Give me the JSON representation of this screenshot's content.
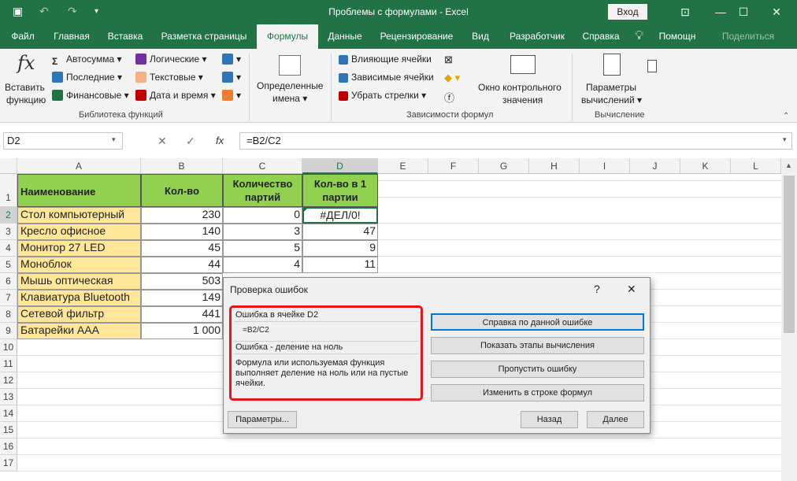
{
  "title_bar": {
    "title": "Проблемы с формулами - Excel",
    "login": "Вход"
  },
  "tabs": [
    "Файл",
    "Главная",
    "Вставка",
    "Разметка страницы",
    "Формулы",
    "Данные",
    "Рецензирование",
    "Вид",
    "Разработчик",
    "Справка",
    "Помощн",
    "Поделиться"
  ],
  "active_tab": "Формулы",
  "ribbon": {
    "insert_function": [
      "Вставить",
      "функцию"
    ],
    "lib_buttons": [
      "Автосумма",
      "Последние",
      "Финансовые",
      "Логические",
      "Текстовые",
      "Дата и время"
    ],
    "library_group": "Библиотека функций",
    "defined_names": [
      "Определенные",
      "имена"
    ],
    "dep_buttons": [
      "Влияющие ячейки",
      "Зависимые ячейки",
      "Убрать стрелки"
    ],
    "watch_window": [
      "Окно контрольного",
      "значения"
    ],
    "dependencies_group": "Зависимости формул",
    "calc_params": [
      "Параметры",
      "вычислений"
    ],
    "calc_group": "Вычисление"
  },
  "formula_bar": {
    "name_box": "D2",
    "fx": "fx",
    "formula": "=B2/C2"
  },
  "columns": [
    "A",
    "B",
    "C",
    "D",
    "E",
    "F",
    "G",
    "H",
    "I",
    "J",
    "K",
    "L"
  ],
  "rows": [
    "1",
    "2",
    "3",
    "4",
    "5",
    "6",
    "7",
    "8",
    "9",
    "10",
    "11",
    "12",
    "13",
    "14",
    "15",
    "16",
    "17"
  ],
  "table": {
    "headers": [
      "Наименование",
      "Кол-во",
      "Количество партий",
      "Кол-во в 1 партии"
    ],
    "rows": [
      [
        "Стол компьютерный",
        "230",
        "0",
        "#ДЕЛ/0!"
      ],
      [
        "Кресло офисное",
        "140",
        "3",
        "47"
      ],
      [
        "Монитор 27 LED",
        "45",
        "5",
        "9"
      ],
      [
        "Моноблок",
        "44",
        "4",
        "11"
      ],
      [
        "Мышь оптическая",
        "503",
        "",
        ""
      ],
      [
        "Клавиатура Bluetooth",
        "149",
        "",
        ""
      ],
      [
        "Сетевой фильтр",
        "441",
        "",
        ""
      ],
      [
        "Батарейки AAA",
        "1 000",
        "",
        ""
      ]
    ]
  },
  "dialog": {
    "title": "Проверка ошибок",
    "help_glyph": "?",
    "close_glyph": "✕",
    "error_cell": "Ошибка в ячейке D2",
    "formula": "=B2/C2",
    "error_type": "Ошибка  - деление на ноль",
    "description": "Формула или используемая функция выполняет деление на ноль или на пустые ячейки.",
    "btn_help": "Справка по данной ошибке",
    "btn_steps": "Показать этапы вычисления",
    "btn_skip": "Пропустить ошибку",
    "btn_edit": "Изменить в строке формул",
    "btn_options": "Параметры...",
    "btn_back": "Назад",
    "btn_next": "Далее"
  },
  "colors": {
    "excel_green": "#217346",
    "header_fill": "#92d050",
    "name_fill": "#ffe699",
    "error_outline": "#e8141c"
  }
}
